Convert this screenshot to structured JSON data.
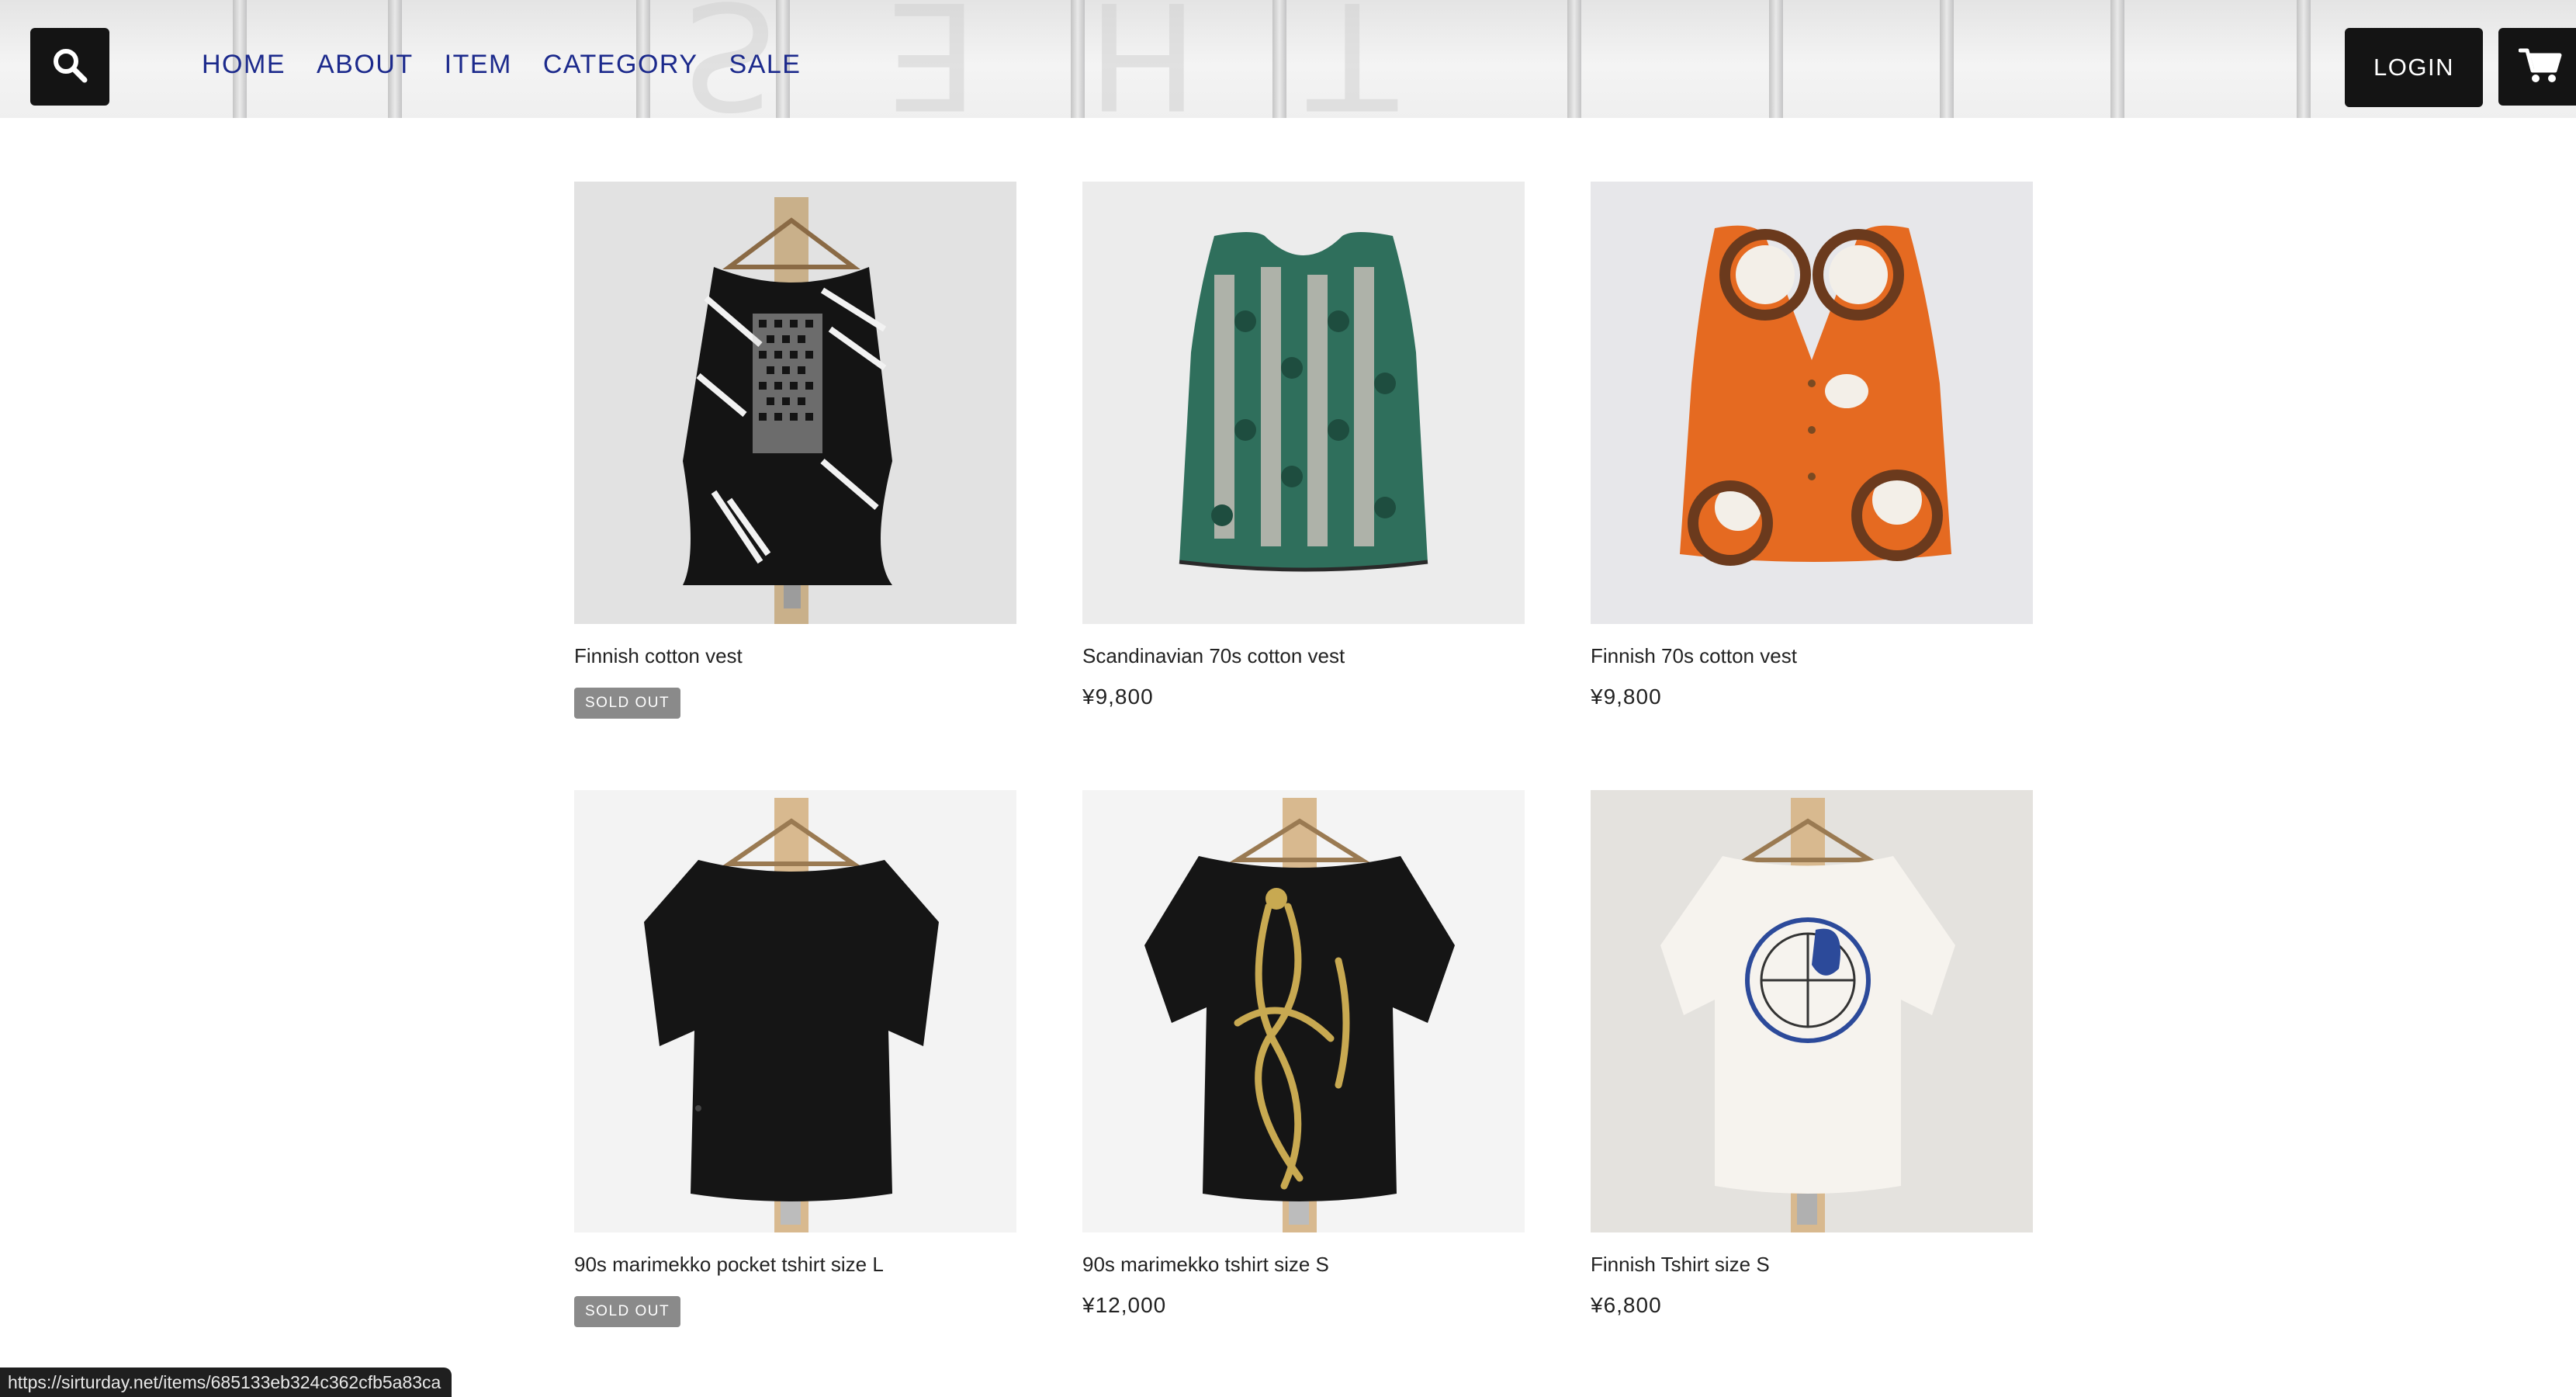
{
  "header": {
    "nav": [
      {
        "label": "HOME"
      },
      {
        "label": "ABOUT"
      },
      {
        "label": "ITEM"
      },
      {
        "label": "CATEGORY"
      },
      {
        "label": "SALE"
      }
    ],
    "login_label": "LOGIN",
    "search_icon": "search-icon",
    "cart_icon": "cart-icon",
    "background_lettering": "THE LESSON"
  },
  "products": [
    {
      "name": "Finnish cotton vest",
      "price": "",
      "badge": "SOLD OUT",
      "image": "black patterned cotton vest on wooden hanger"
    },
    {
      "name": "Scandinavian 70s cotton vest",
      "price": "¥9,800",
      "badge": "",
      "image": "green patterned sleeveless vest"
    },
    {
      "name": "Finnish 70s cotton vest",
      "price": "¥9,800",
      "badge": "",
      "image": "orange vest with brown and white circles"
    },
    {
      "name": "90s marimekko pocket tshirt size L",
      "price": "",
      "badge": "SOLD OUT",
      "image": "black pocket t-shirt on hanger"
    },
    {
      "name": "90s marimekko tshirt size S",
      "price": "¥12,000",
      "badge": "",
      "image": "black t-shirt with gold figure print"
    },
    {
      "name": "Finnish Tshirt size S",
      "price": "¥6,800",
      "badge": "",
      "image": "white t-shirt with blue globe print"
    }
  ],
  "status_bar": {
    "url": "https://sirturday.net/items/685133eb324c362cfb5a83ca"
  },
  "colors": {
    "nav_text": "#1c2a8c",
    "button_bg": "#141414",
    "badge_bg": "#8a8a8a"
  }
}
